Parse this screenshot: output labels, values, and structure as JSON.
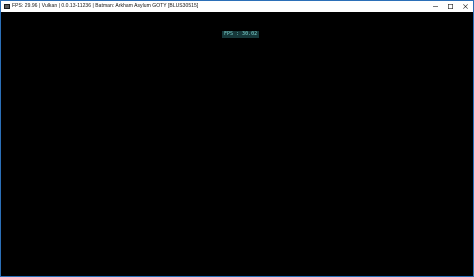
{
  "window": {
    "title": "FPS: 29.96 | Vulkan | 0.0.13-11236 | Batman: Arkham Asylum GOTY [BLUS30515]",
    "icon": "rpcs3-app-icon"
  },
  "controls": {
    "minimize_icon": "minimize-icon",
    "maximize_icon": "maximize-icon",
    "close_icon": "close-icon"
  },
  "overlay": {
    "fps_text": "FPS : 30.02"
  },
  "colors": {
    "viewport_bg": "#000000",
    "overlay_bg": "#16383a",
    "overlay_text": "#7fd6d2"
  }
}
